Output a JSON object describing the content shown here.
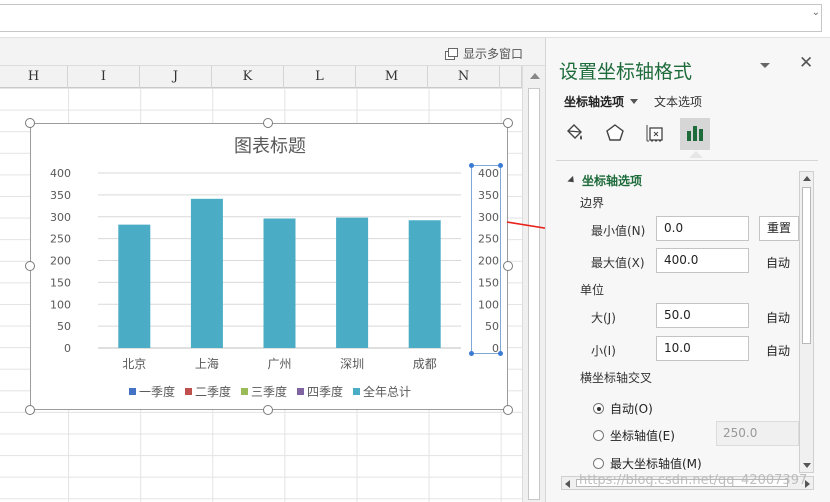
{
  "sheet": {
    "multi_window_label": "显示多窗口",
    "columns": [
      "H",
      "I",
      "J",
      "K",
      "L",
      "M",
      "N"
    ]
  },
  "chart_data": {
    "type": "bar",
    "title": "图表标题",
    "categories": [
      "北京",
      "上海",
      "广州",
      "深圳",
      "成都"
    ],
    "series": [
      {
        "name": "一季度",
        "values": [],
        "color": "#4472c4"
      },
      {
        "name": "二季度",
        "values": [],
        "color": "#c0504d"
      },
      {
        "name": "三季度",
        "values": [],
        "color": "#9bbb59"
      },
      {
        "name": "四季度",
        "values": [],
        "color": "#8064a2"
      },
      {
        "name": "全年总计",
        "values": [
          282,
          341,
          296,
          298,
          292
        ],
        "color": "#4bacc6"
      }
    ],
    "ylim": [
      0,
      400
    ],
    "yticks": [
      0,
      50,
      100,
      150,
      200,
      250,
      300,
      350,
      400
    ],
    "secondary_yticks": [
      0,
      50,
      100,
      150,
      200,
      250,
      300,
      350,
      400
    ],
    "grid": true,
    "legend_position": "bottom"
  },
  "pane": {
    "title": "设置坐标轴格式",
    "close_label": "✕",
    "tab_axis_options": "坐标轴选项",
    "tab_text_options": "文本选项",
    "section_title": "坐标轴选项",
    "bounds_label": "边界",
    "min_label": "最小值(N)",
    "min_value": "0.0",
    "reset_label": "重置",
    "max_label": "最大值(X)",
    "max_value": "400.0",
    "max_auto": "自动",
    "units_label": "单位",
    "major_label": "大(J)",
    "major_value": "50.0",
    "major_auto": "自动",
    "minor_label": "小(I)",
    "minor_value": "10.0",
    "minor_auto": "自动",
    "cross_label": "横坐标轴交叉",
    "radio_auto": "自动(O)",
    "radio_axis_value": "坐标轴值(E)",
    "axis_value_field": "250.0",
    "radio_max_axis": "最大坐标轴值(M)"
  },
  "watermark": "https://blog.csdn.net/qq_42007397"
}
